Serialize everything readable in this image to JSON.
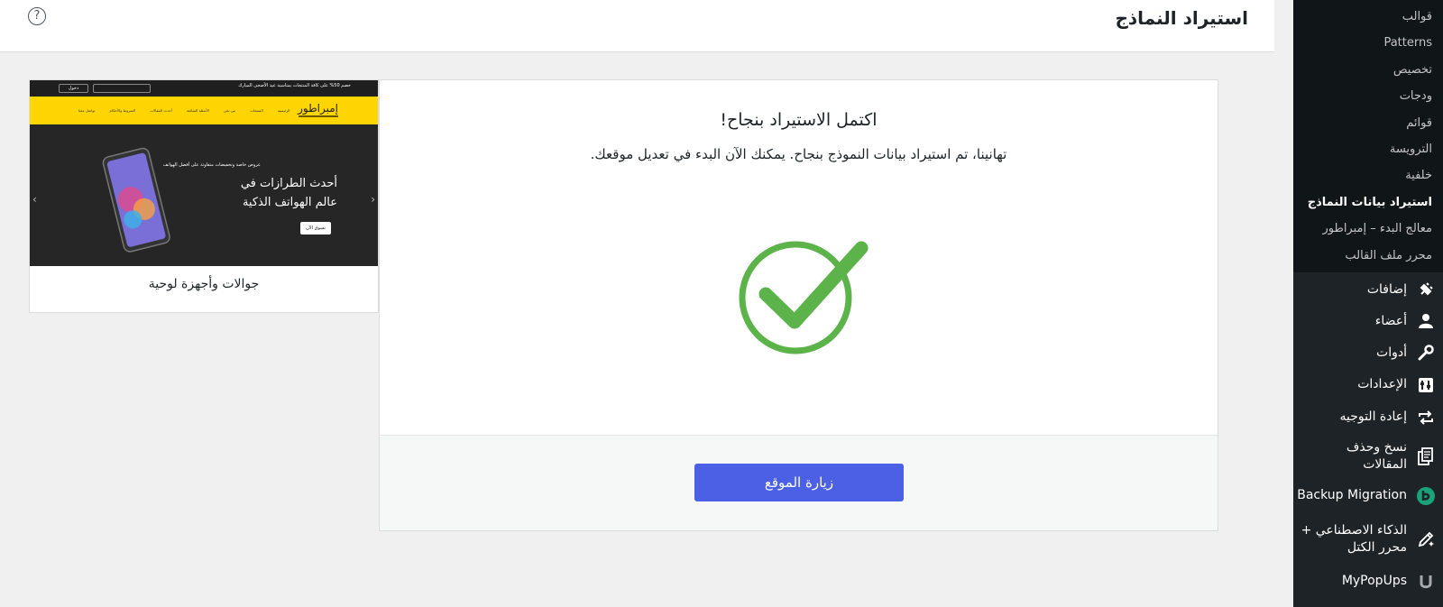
{
  "page": {
    "title": "استيراد النماذج",
    "help_icon": "?"
  },
  "sidebar": {
    "submenu": [
      "قوالب",
      "Patterns",
      "تخصيص",
      "ودجات",
      "قوائم",
      "الترويسة",
      "خلفية",
      "استيراد بيانات النماذج",
      "معالج البدء – إمبراطور",
      "محرر ملف القالب"
    ],
    "menu": [
      {
        "label": "إضافات",
        "icon": "plugin-icon"
      },
      {
        "label": "أعضاء",
        "icon": "user-icon"
      },
      {
        "label": "أدوات",
        "icon": "wrench-icon"
      },
      {
        "label": "الإعدادات",
        "icon": "settings-icon"
      },
      {
        "label": "إعادة التوجيه",
        "icon": "redirect-icon"
      },
      {
        "label": "نسخ وحذف المقالات",
        "icon": "copy-delete-icon"
      },
      {
        "label": "Backup Migration",
        "icon": "backup-migration-icon"
      },
      {
        "label": "الذكاء الاصطناعي + محرر الكتل",
        "icon": "ai-pen-icon"
      },
      {
        "label": "MyPopUps",
        "icon": "mypopups-icon"
      }
    ]
  },
  "success": {
    "title": "اكتمل الاستيراد بنجاح!",
    "message": "تهانينا، تم استيراد بيانات النموذج بنجاح. يمكنك الآن البدء في تعديل موقعك.",
    "icon": "check-circle-icon",
    "button_label": "زيارة الموقع",
    "colors": {
      "check": "#5bb34a",
      "button": "#4c60e6"
    }
  },
  "demo": {
    "label": "جوالات وأجهزة لوحية",
    "preview": {
      "topbar_text": "خصم 50% على كافة المنتجات بمناسبة عيد الأضحى المبارك",
      "topbar_btn": "دخول",
      "logo": "إمبراطور",
      "nav": [
        "الرئيسية",
        "المنتجات",
        "من نحن",
        "الأسئلة الشائعة",
        "أحدث المقالات",
        "الشروط والأحكام",
        "تواصل معنا"
      ],
      "hero_small": "عروض خاصة وتخفيضات متفاوتة على أفضل الهواتف",
      "hero_line1": "أحدث الطرازات في",
      "hero_line2": "عالم الهواتف الذكية",
      "hero_btn": "تسوق الآن"
    }
  }
}
